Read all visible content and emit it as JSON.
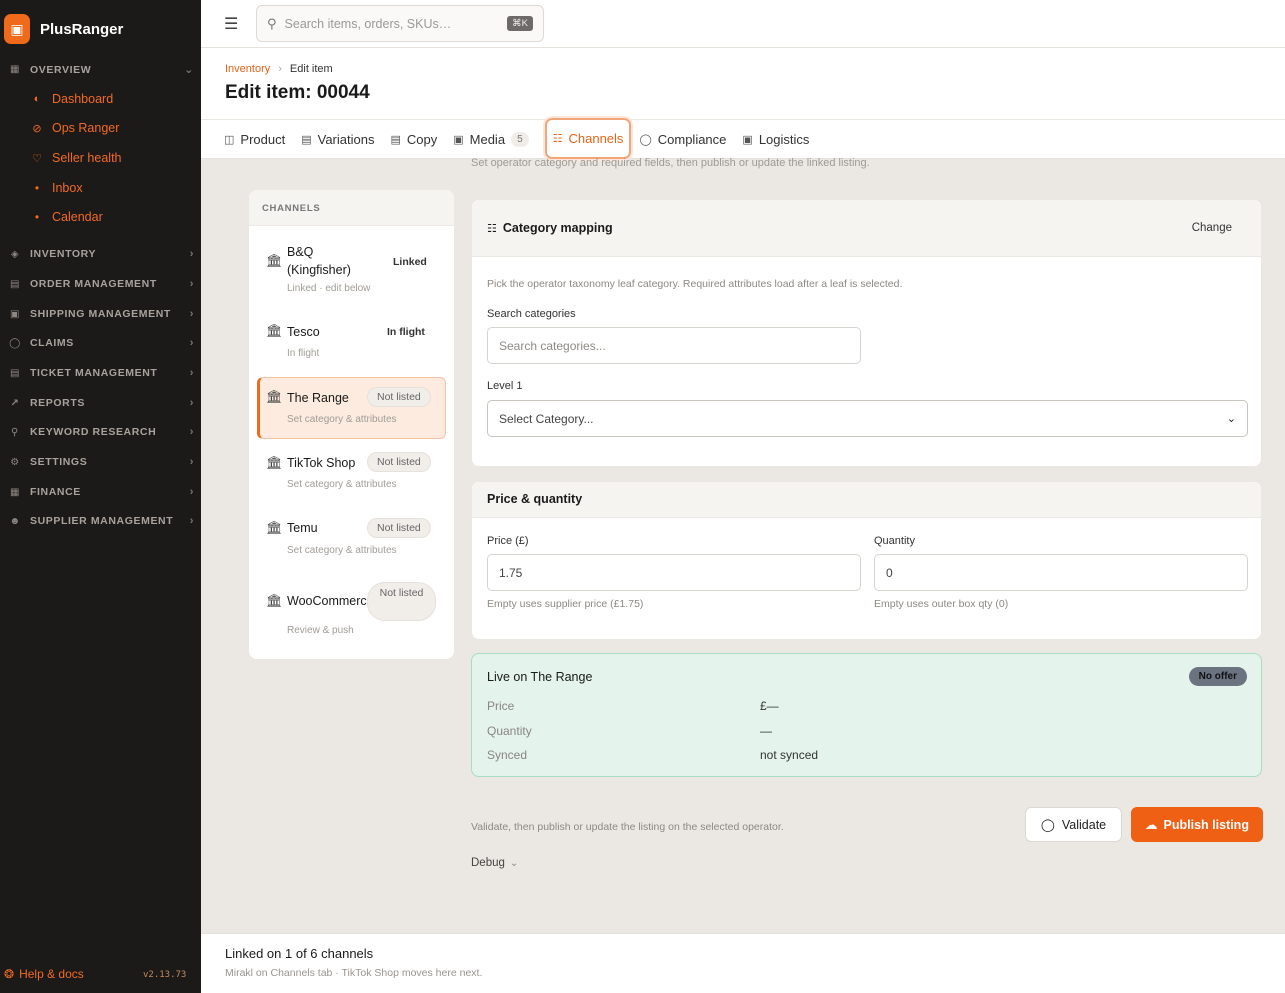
{
  "brand": {
    "name": "PlusRanger",
    "logo_icon": "box-icon",
    "accent": "#ef6a1a"
  },
  "sidebar": {
    "overview": {
      "label": "OVERVIEW",
      "items": [
        {
          "label": "Dashboard",
          "icon": "gauge-icon"
        },
        {
          "label": "Ops Ranger",
          "icon": "compass-icon"
        },
        {
          "label": "Seller health",
          "icon": "heart-icon"
        },
        {
          "label": "Inbox",
          "icon": "dot"
        },
        {
          "label": "Calendar",
          "icon": "dot"
        }
      ]
    },
    "sections": [
      {
        "label": "INVENTORY"
      },
      {
        "label": "ORDER MANAGEMENT"
      },
      {
        "label": "SHIPPING MANAGEMENT"
      },
      {
        "label": "CLAIMS"
      },
      {
        "label": "TICKET MANAGEMENT"
      },
      {
        "label": "REPORTS"
      },
      {
        "label": "KEYWORD RESEARCH"
      },
      {
        "label": "SETTINGS"
      },
      {
        "label": "FINANCE"
      },
      {
        "label": "SUPPLIER MANAGEMENT"
      }
    ],
    "help": "Help & docs",
    "version": "v2.13.73"
  },
  "topbar": {
    "search_placeholder": "Search items, orders, SKUs…",
    "shortcut": "⌘K"
  },
  "breadcrumb": {
    "root": "Inventory",
    "current": "Edit item"
  },
  "page_title": "Edit item: 00044",
  "tabs": [
    {
      "label": "Product"
    },
    {
      "label": "Variations"
    },
    {
      "label": "Copy"
    },
    {
      "label": "Media",
      "badge": "5"
    },
    {
      "label": "Channels",
      "active": true
    },
    {
      "label": "Compliance"
    },
    {
      "label": "Logistics"
    }
  ],
  "faded_hint": "Set operator category and required fields, then publish or update the linked listing.",
  "channels": {
    "heading": "CHANNELS",
    "items": [
      {
        "name": "B&Q (Kingfisher)",
        "status": "Linked",
        "sub": "Linked · edit below"
      },
      {
        "name": "Tesco",
        "status": "In flight",
        "sub": "In flight"
      },
      {
        "name": "The Range",
        "status": "Not listed",
        "sub": "Set category & attributes",
        "selected": true
      },
      {
        "name": "TikTok Shop",
        "status": "Not listed",
        "sub": "Set category & attributes"
      },
      {
        "name": "Temu",
        "status": "Not listed",
        "sub": "Set category & attributes"
      },
      {
        "name": "WooCommerce",
        "status": "Not listed",
        "sub": "Review & push"
      }
    ]
  },
  "category_mapping": {
    "title": "Category mapping",
    "change": "Change",
    "hint": "Pick the operator taxonomy leaf category. Required attributes load after a leaf is selected.",
    "search_label": "Search categories",
    "search_placeholder": "Search categories...",
    "level_label": "Level 1",
    "level_value": "Select Category..."
  },
  "price_qty": {
    "title": "Price & quantity",
    "price_label": "Price (£)",
    "price_value": "1.75",
    "price_hint": "Empty uses supplier price (£1.75)",
    "qty_label": "Quantity",
    "qty_value": "0",
    "qty_hint": "Empty uses outer box qty (0)"
  },
  "live": {
    "title": "Live on The Range",
    "badge": "No offer",
    "rows": [
      {
        "key": "Price",
        "value": "£—"
      },
      {
        "key": "Quantity",
        "value": "—"
      },
      {
        "key": "Synced",
        "value": "not synced"
      }
    ]
  },
  "actions": {
    "hint": "Validate, then publish or update the listing on the selected operator.",
    "validate": "Validate",
    "publish": "Publish listing",
    "debug": "Debug"
  },
  "bottom": {
    "title": "Linked on 1 of 6 channels",
    "sub": "Mirakl on Channels tab · TikTok Shop moves here next."
  }
}
